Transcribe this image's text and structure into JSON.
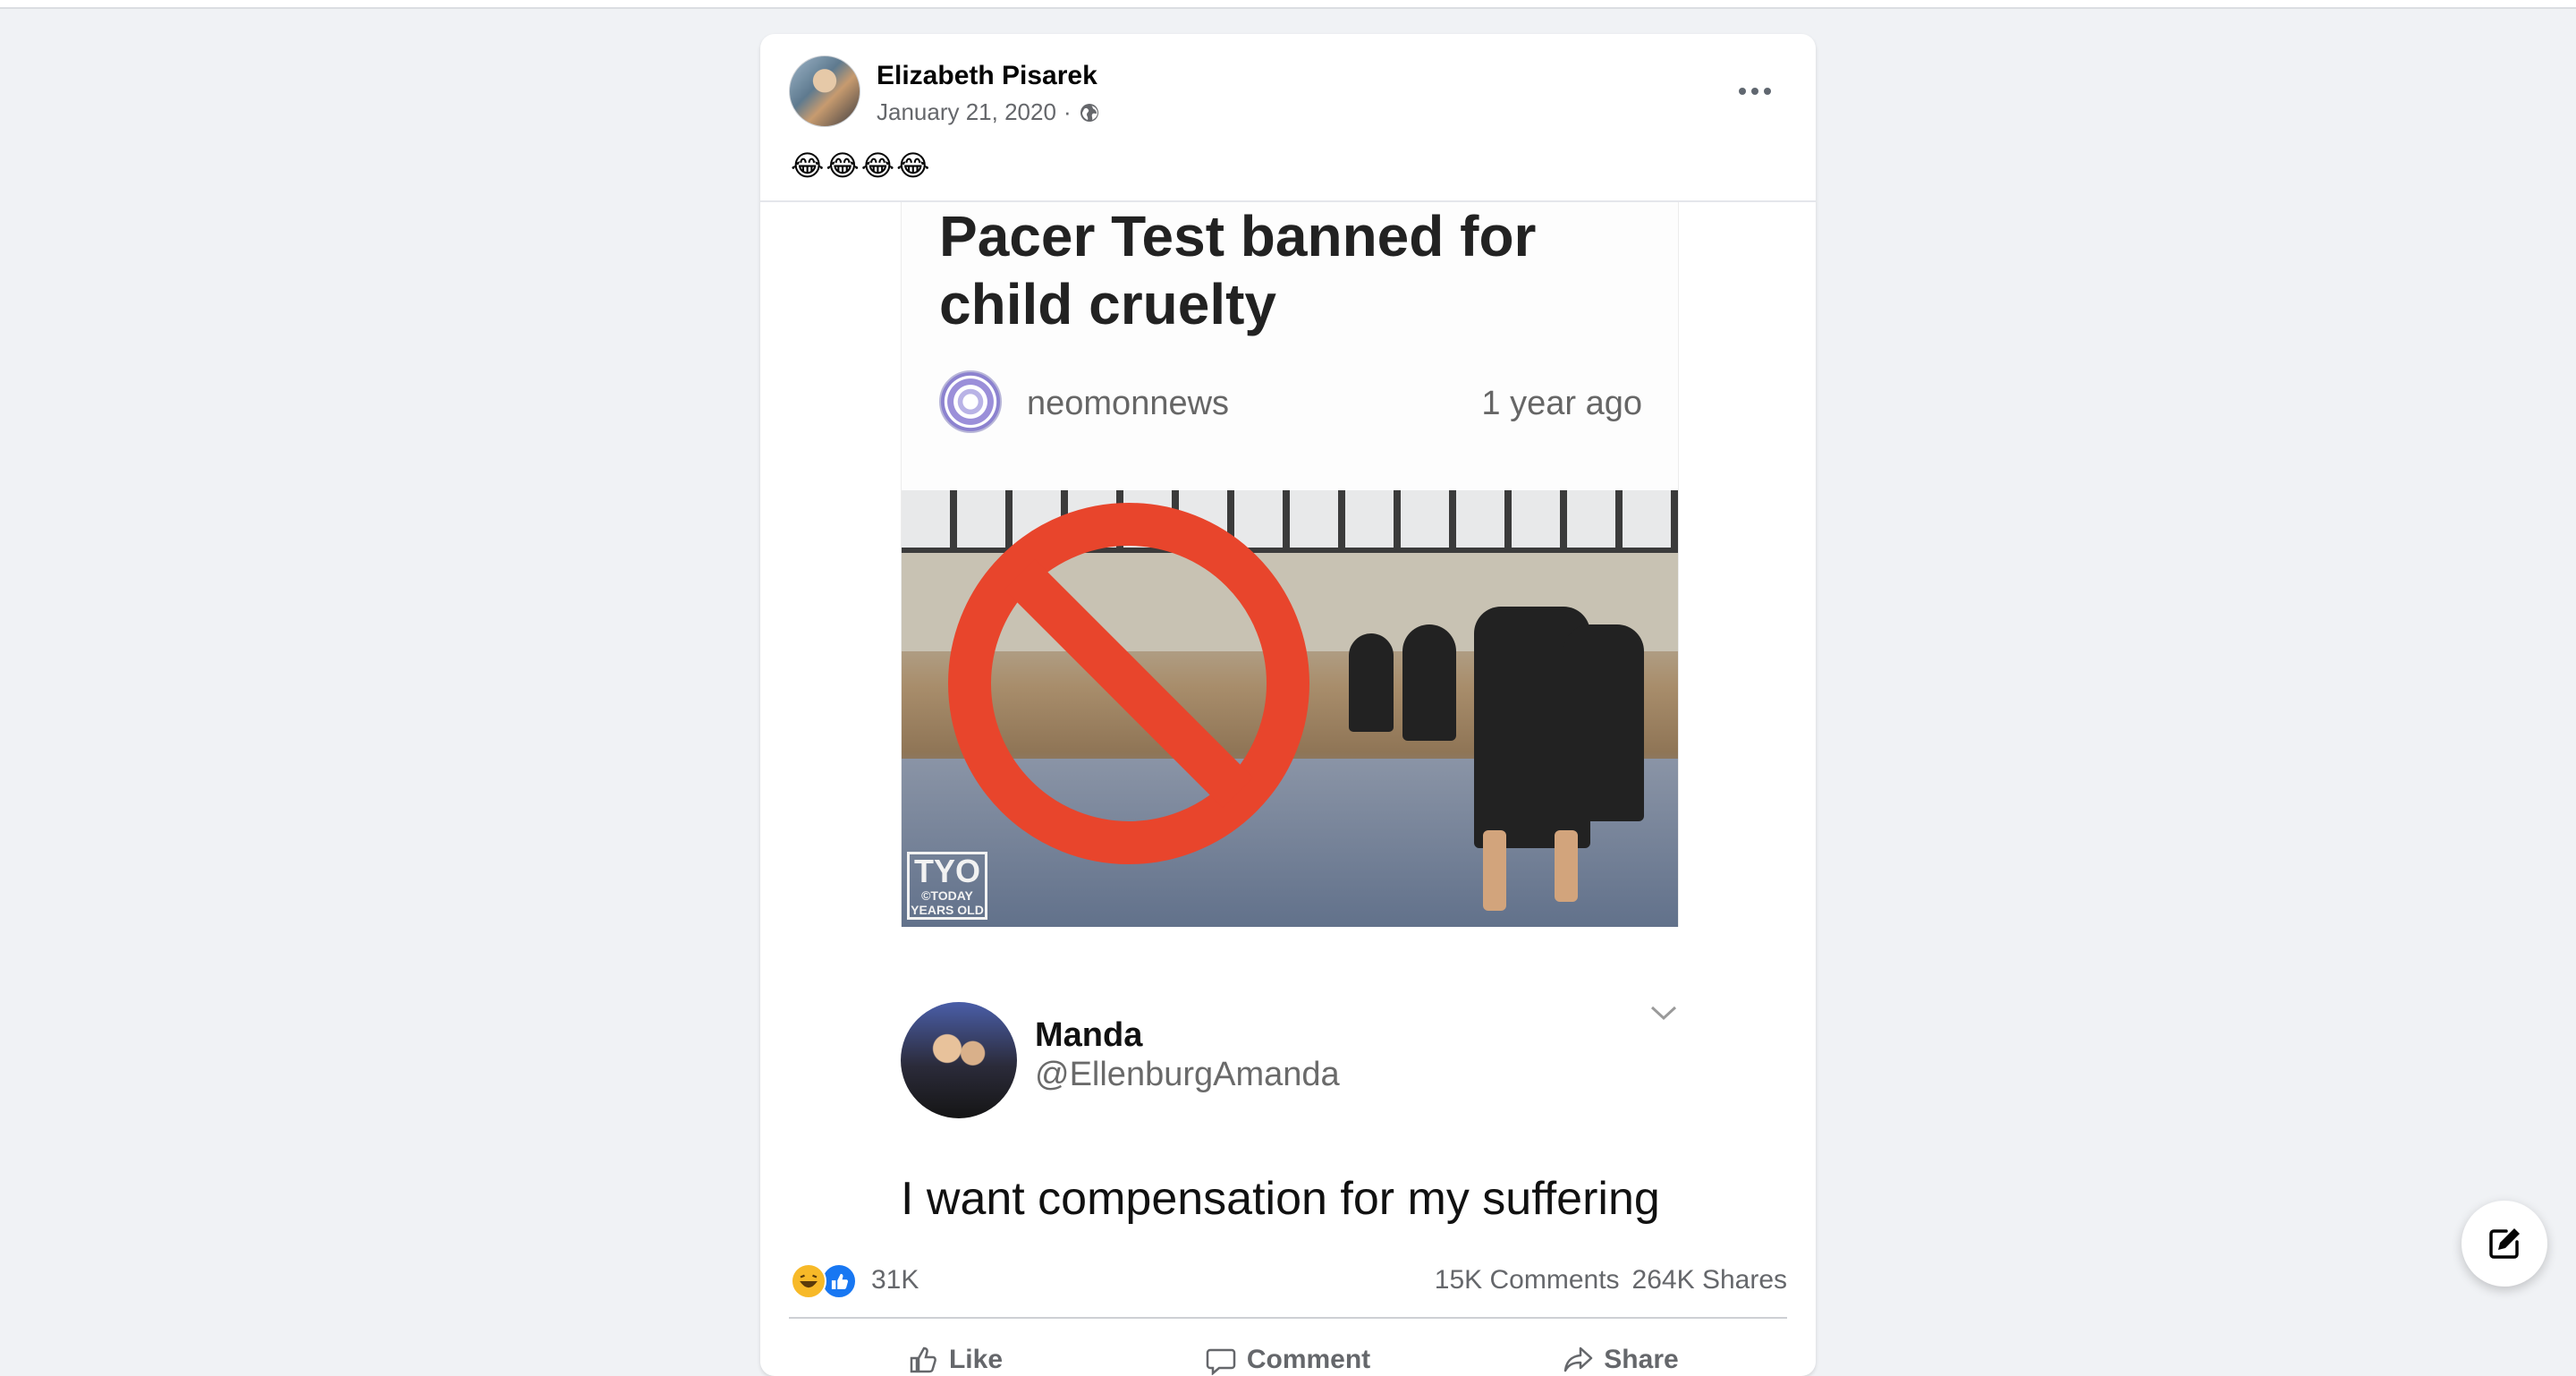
{
  "post": {
    "author": "Elizabeth Pisarek",
    "date": "January 21, 2020",
    "separator": "·",
    "audience_icon": "globe-icon",
    "caption": "😂😂😂😂"
  },
  "media": {
    "headline": "Pacer Test banned for child cruelty",
    "source_name": "neomonnews",
    "source_time": "1 year ago",
    "watermark_big": "TYO",
    "watermark_small": "©TODAY YEARS OLD",
    "tweet": {
      "name": "Manda",
      "handle": "@EllenburgAmanda",
      "text": "I want compensation for my suffering"
    }
  },
  "engagement": {
    "reaction_icons": [
      "haha-icon",
      "like-icon"
    ],
    "reaction_count": "31K",
    "comments": "15K Comments",
    "shares": "264K Shares"
  },
  "actions": {
    "like": "Like",
    "comment": "Comment",
    "share": "Share"
  },
  "colors": {
    "page_bg": "#f0f2f5",
    "secondary_text": "#65676b",
    "like_blue": "#1877f2",
    "ban_red": "#e8452c"
  }
}
